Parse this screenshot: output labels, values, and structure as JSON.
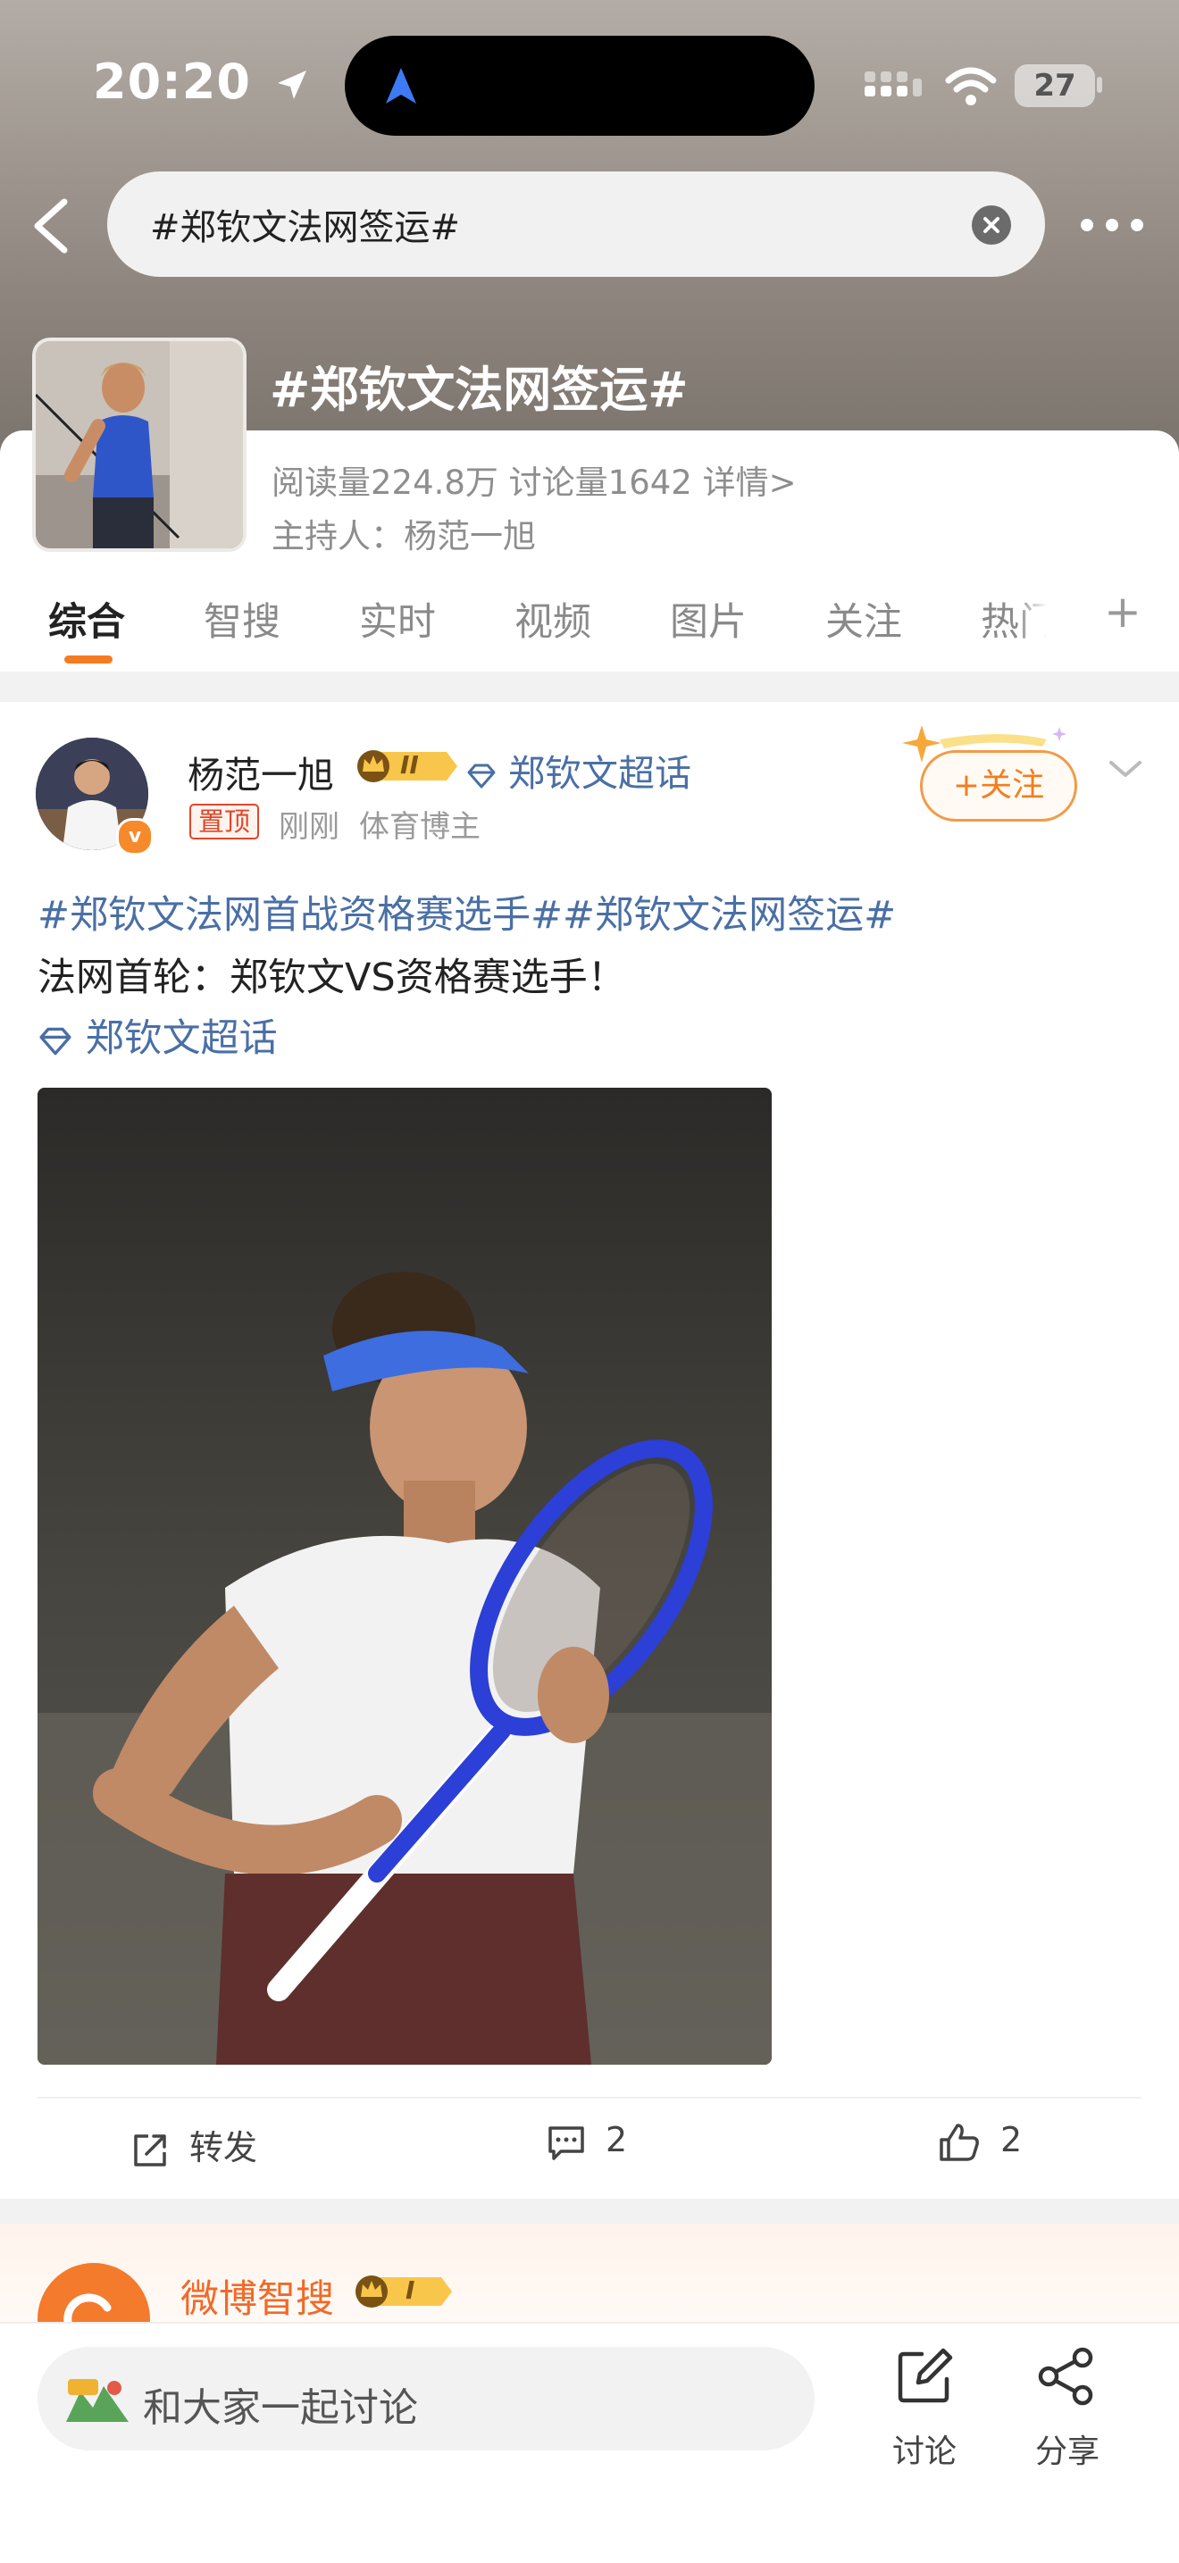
{
  "status_bar": {
    "time": "20:20",
    "battery": "27"
  },
  "search": {
    "query": "#郑钦文法网签运#"
  },
  "topic": {
    "title": "#郑钦文法网签运#",
    "stats": "阅读量224.8万   讨论量1642   详情>",
    "host": "主持人：杨范一旭"
  },
  "tabs": [
    "综合",
    "智搜",
    "实时",
    "视频",
    "图片",
    "关注",
    "热门"
  ],
  "tab_add": "+",
  "post": {
    "author": "杨范一旭",
    "rank_badge": "II",
    "super_topic": "郑钦文超话",
    "pin_label": "置顶",
    "time": "刚刚",
    "role": "体育博主",
    "follow_label": "+关注",
    "hashtags": "#郑钦文法网首战资格赛选手##郑钦文法网签运#",
    "body": "法网首轮：郑钦文VS资格赛选手！",
    "super_link": "郑钦文超话",
    "repost_label": "转发",
    "comment_count": "2",
    "like_count": "2",
    "avatar_badge": "v"
  },
  "next_card": {
    "name": "微博智搜",
    "rank_badge": "I"
  },
  "bottom_bar": {
    "comment_placeholder": "和大家一起讨论",
    "discuss_label": "讨论",
    "share_label": "分享"
  }
}
